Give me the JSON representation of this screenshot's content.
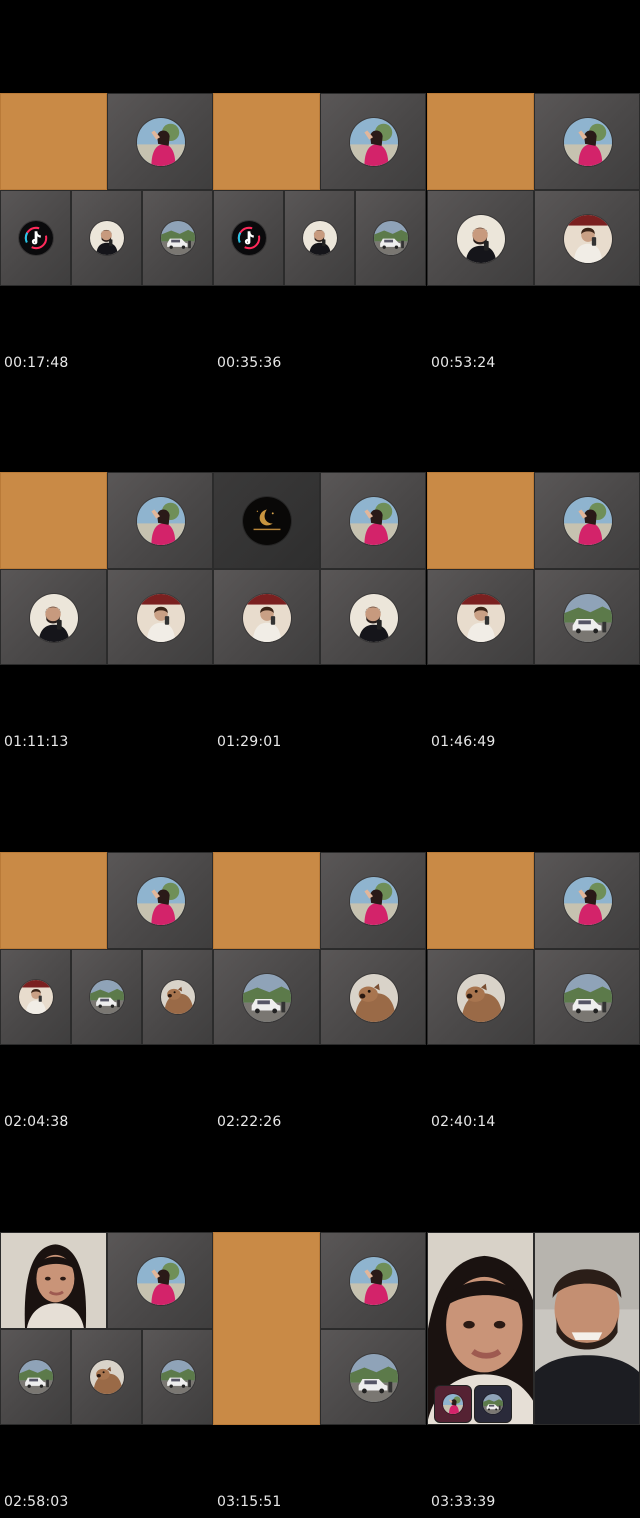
{
  "frames": [
    {
      "timestamp": "00:17:48"
    },
    {
      "timestamp": "00:35:36"
    },
    {
      "timestamp": "00:53:24"
    },
    {
      "timestamp": "01:11:13"
    },
    {
      "timestamp": "01:29:01"
    },
    {
      "timestamp": "01:46:49"
    },
    {
      "timestamp": "02:04:38"
    },
    {
      "timestamp": "02:22:26"
    },
    {
      "timestamp": "02:40:14"
    },
    {
      "timestamp": "02:58:03"
    },
    {
      "timestamp": "03:15:51"
    },
    {
      "timestamp": "03:33:39"
    }
  ],
  "colors": {
    "background": "#000000",
    "tile_gray": "#555252",
    "tile_orange": "#c98a46",
    "timestamp_text": "#e8e8e8"
  },
  "icons": [
    "avatar-woman-pink-icon",
    "avatar-man-beard-icon",
    "avatar-car-icon",
    "avatar-tiktok-logo-icon",
    "avatar-moon-logo-icon",
    "avatar-dog-icon",
    "avatar-mirror-selfie-icon"
  ]
}
